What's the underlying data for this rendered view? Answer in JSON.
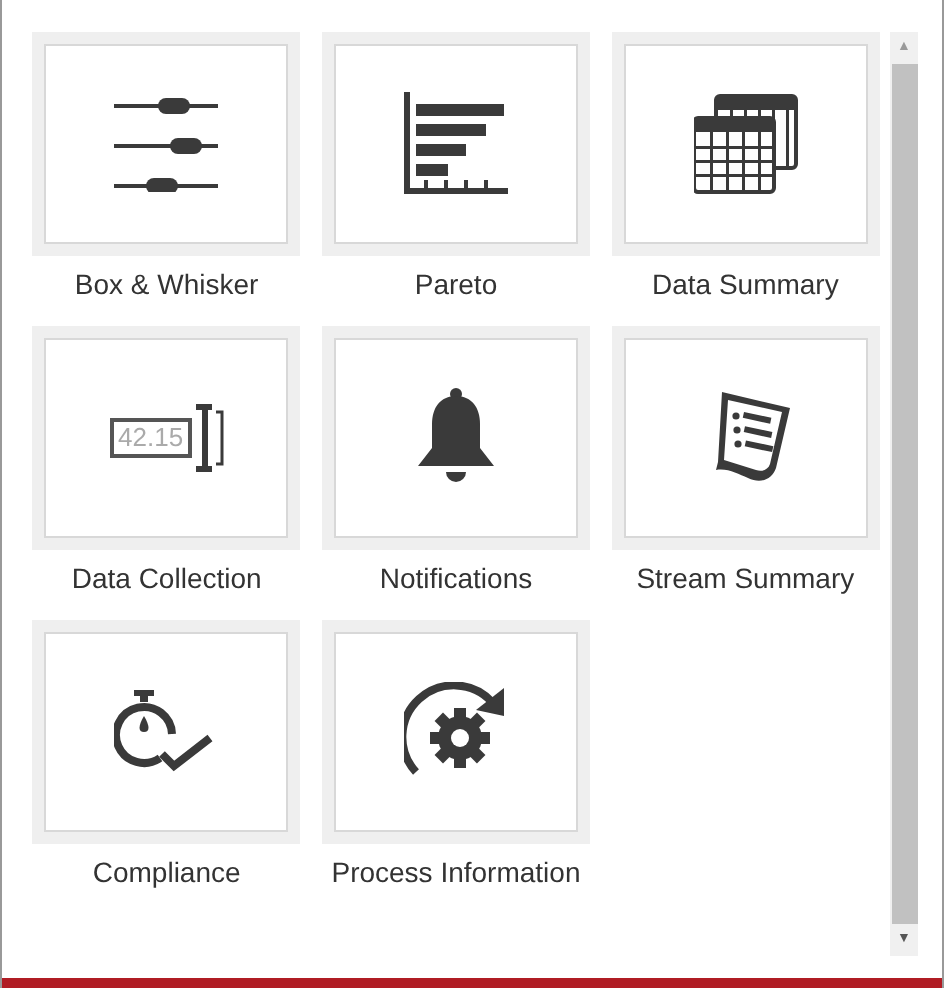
{
  "tiles": [
    {
      "kind": "box-whisker",
      "label": "Box & Whisker"
    },
    {
      "kind": "pareto",
      "label": "Pareto"
    },
    {
      "kind": "data-summary",
      "label": "Data Summary"
    },
    {
      "kind": "data-collection",
      "label": "Data Collection",
      "icon_text": "42.15"
    },
    {
      "kind": "notifications",
      "label": "Notifications"
    },
    {
      "kind": "stream-summary",
      "label": "Stream Summary"
    },
    {
      "kind": "compliance",
      "label": "Compliance"
    },
    {
      "kind": "process-information",
      "label": "Process Information"
    }
  ],
  "scrollbar": {
    "up": "▲",
    "down": "▼"
  }
}
